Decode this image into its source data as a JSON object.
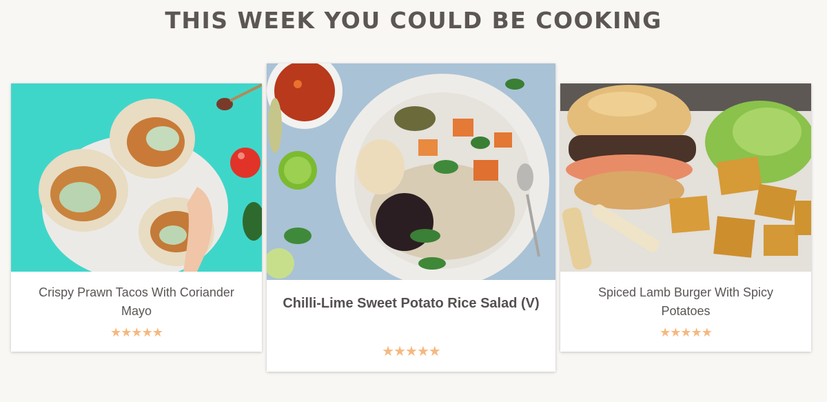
{
  "section": {
    "heading": "THIS WEEK YOU COULD BE COOKING"
  },
  "recipes": [
    {
      "title": "Crispy Prawn Tacos With Coriander Mayo",
      "rating": 5,
      "stars": "★★★★★",
      "image_icon": "prawn-tacos-photo",
      "background_color": "#3ed5c9"
    },
    {
      "title": "Chilli-Lime Sweet Potato Rice Salad (V)",
      "rating": 5,
      "stars": "★★★★★",
      "image_icon": "rice-salad-photo",
      "background_color": "#a9c3d6"
    },
    {
      "title": "Spiced Lamb Burger With Spicy Potatoes",
      "rating": 5,
      "stars": "★★★★★",
      "image_icon": "lamb-burger-photo",
      "background_color": "#d8d4ce"
    }
  ],
  "colors": {
    "heading": "#5c5754",
    "star": "#f6b880",
    "card_text": "#5a5553"
  }
}
